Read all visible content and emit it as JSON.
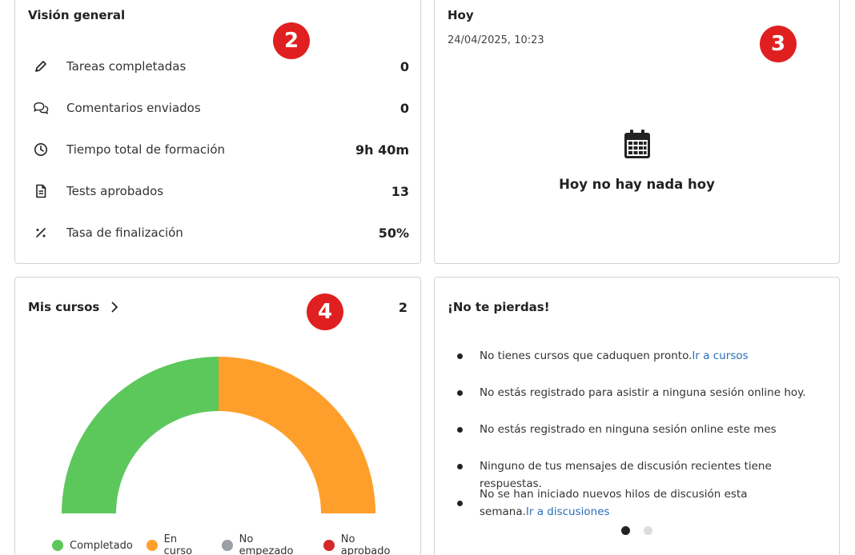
{
  "overview": {
    "title": "Visión general",
    "badge": "2",
    "stats": [
      {
        "label": "Tareas completadas",
        "value": "0",
        "icon": "pencil-icon"
      },
      {
        "label": "Comentarios enviados",
        "value": "0",
        "icon": "comments-icon"
      },
      {
        "label": "Tiempo total de formación",
        "value": "9h 40m",
        "icon": "clock-icon"
      },
      {
        "label": "Tests aprobados",
        "value": "13",
        "icon": "document-icon"
      },
      {
        "label": "Tasa de finalización",
        "value": "50%",
        "icon": "percent-icon"
      }
    ]
  },
  "today": {
    "title": "Hoy",
    "datetime": "24/04/2025, 10:23",
    "empty_message": "Hoy no hay nada hoy",
    "badge": "3",
    "icon": "calendar-icon"
  },
  "courses": {
    "title": "Mis cursos",
    "count": "2",
    "badge": "4",
    "legend": [
      {
        "label": "Completado",
        "color": "#5cc85c"
      },
      {
        "label": "En curso",
        "color": "#ff9f2b"
      },
      {
        "label": "No empezado",
        "color": "#9aa0a6"
      },
      {
        "label": "No aprobado",
        "color": "#d62828"
      }
    ],
    "chart_data": {
      "type": "pie",
      "shape": "half-donut",
      "categories": [
        "Completado",
        "En curso",
        "No empezado",
        "No aprobado"
      ],
      "values": [
        1,
        1,
        0,
        0
      ],
      "colors": [
        "#5cc85c",
        "#ff9f2b",
        "#9aa0a6",
        "#d62828"
      ]
    }
  },
  "dont_miss": {
    "title": "¡No te pierdas!",
    "items": [
      {
        "text": "No tienes cursos que caduquen pronto.",
        "link": "Ir a cursos"
      },
      {
        "text": "No estás registrado para asistir a ninguna sesión online hoy.",
        "link": ""
      },
      {
        "text": "No estás registrado en ninguna sesión online este mes",
        "link": ""
      },
      {
        "text": "Ninguno de tus mensajes de discusión recientes tiene respuestas.",
        "link": ""
      },
      {
        "text": "No se han iniciado nuevos hilos de discusión esta semana.",
        "link": "Ir a discusiones"
      }
    ],
    "carousel": {
      "active_index": 0,
      "count": 2
    }
  }
}
